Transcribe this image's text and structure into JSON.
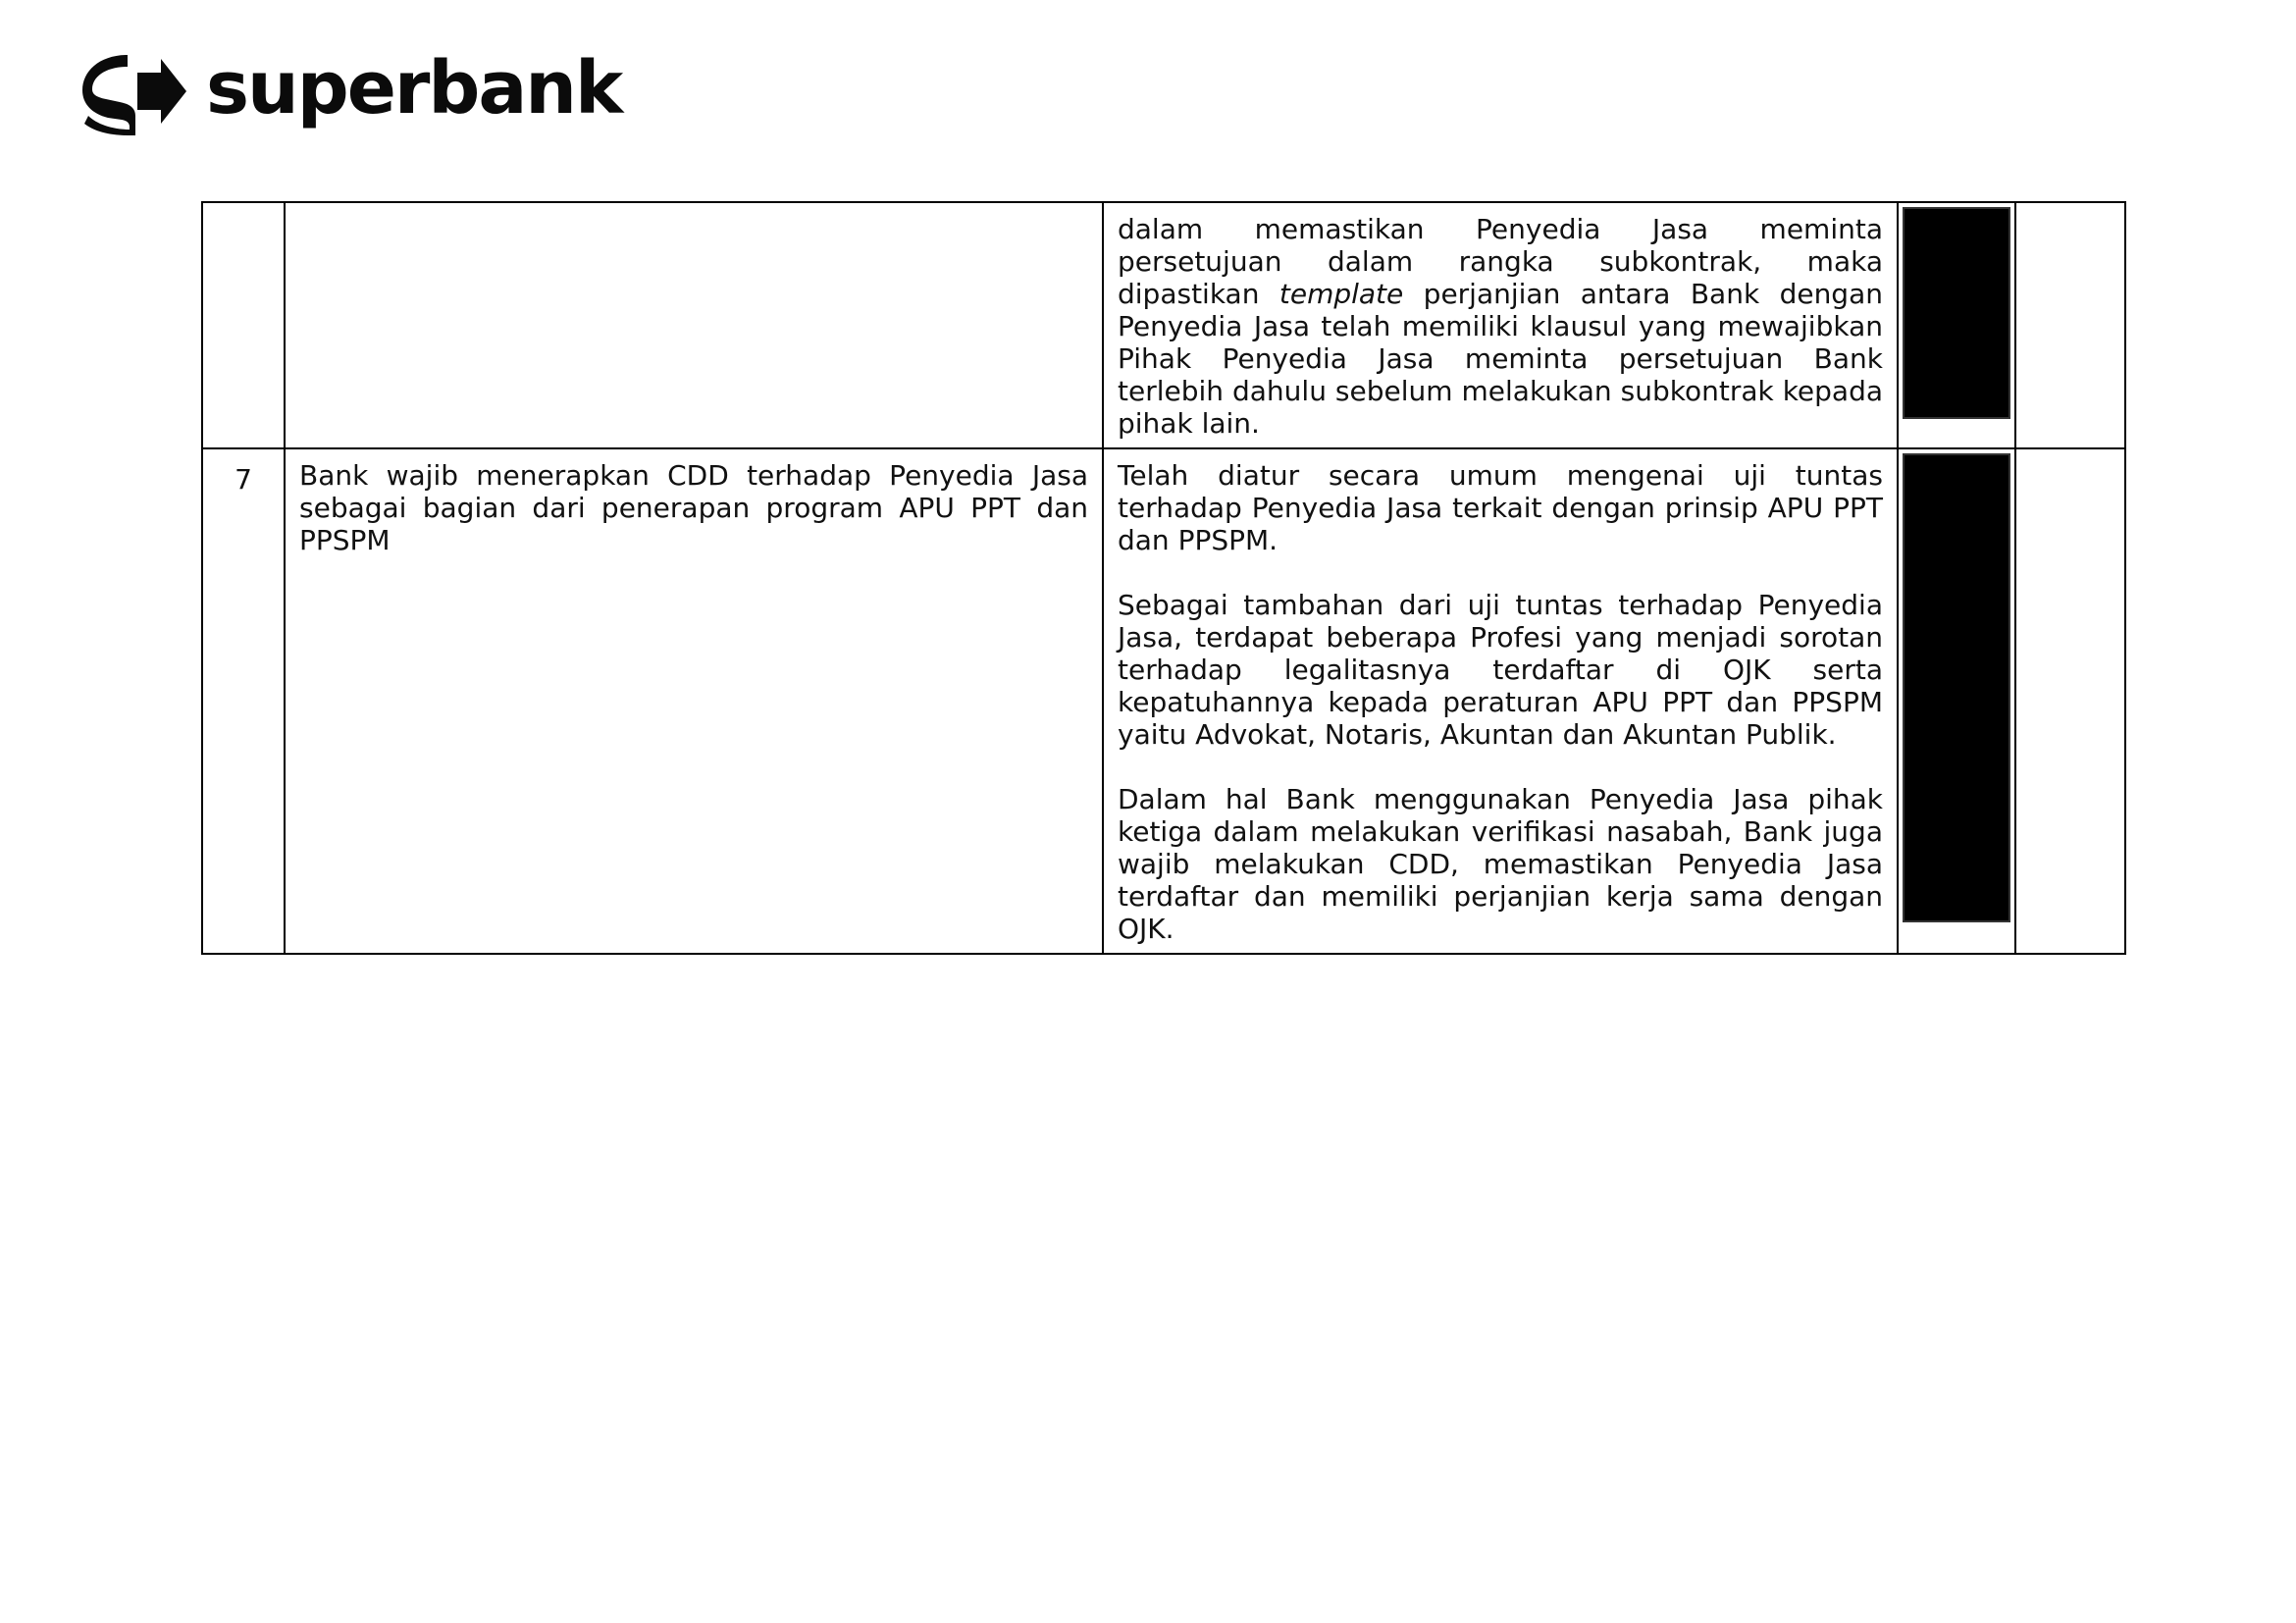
{
  "brand": {
    "name": "superbank",
    "logo_icon": "superbank-s-arrow-icon",
    "color": "#0b0b0b"
  },
  "table": {
    "rows": [
      {
        "number": "",
        "requirement": "",
        "response_paragraphs": [
          {
            "before": "dalam memastikan Penyedia Jasa meminta persetujuan dalam rangka subkontrak, maka dipastikan ",
            "italic": "template",
            "after": " perjanjian antara Bank dengan Penyedia Jasa telah memiliki klausul yang mewajibkan Pihak Penyedia Jasa meminta persetujuan Bank terlebih dahulu sebelum melakukan subkontrak kepada pihak lain."
          }
        ],
        "redacted": true,
        "last": ""
      },
      {
        "number": "7",
        "requirement": "Bank wajib menerapkan CDD terhadap Penyedia Jasa sebagai bagian dari penerapan program APU PPT dan PPSPM",
        "response_paragraphs": [
          {
            "before": "Telah diatur secara umum mengenai uji tuntas terhadap Penyedia Jasa terkait dengan prinsip APU PPT dan PPSPM.",
            "italic": "",
            "after": ""
          },
          {
            "before": "Sebagai tambahan dari uji tuntas terhadap Penyedia Jasa, terdapat beberapa Profesi yang menjadi sorotan terhadap legalitasnya terdaftar di OJK serta kepatuhannya kepada peraturan APU PPT dan PPSPM yaitu Advokat, Notaris, Akuntan dan Akuntan Publik.",
            "italic": "",
            "after": ""
          },
          {
            "before": "Dalam hal Bank menggunakan Penyedia Jasa pihak ketiga dalam melakukan verifikasi nasabah, Bank juga wajib melakukan CDD, memastikan Penyedia Jasa terdaftar dan memiliki perjanjian kerja sama dengan OJK.",
            "italic": "",
            "after": ""
          }
        ],
        "redacted": true,
        "last": ""
      }
    ]
  }
}
